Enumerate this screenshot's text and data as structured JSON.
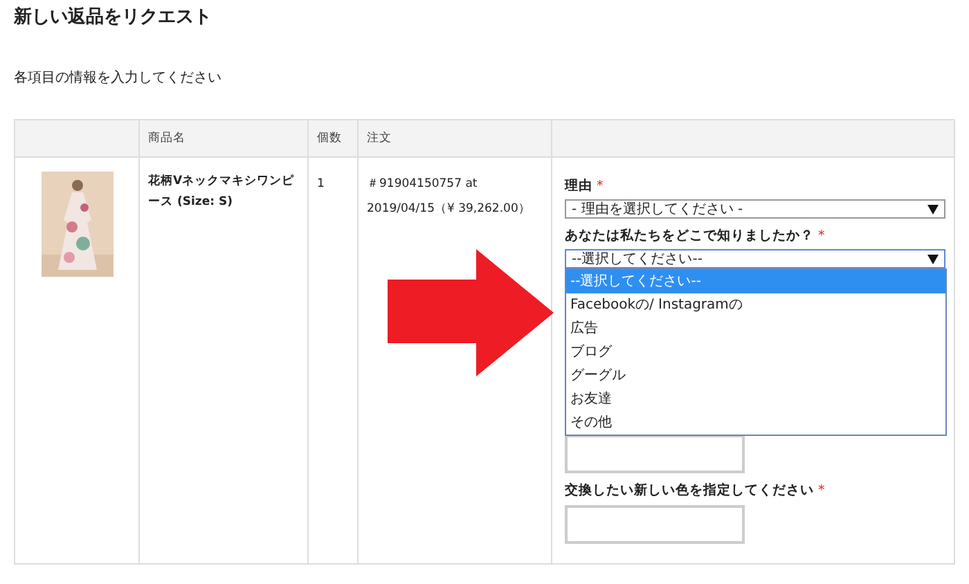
{
  "page": {
    "title": "新しい返品をリクエスト",
    "subtitle": "各項目の情報を入力してください"
  },
  "table": {
    "columns": [
      "商品名",
      "個数",
      "注文"
    ],
    "rows": [
      {
        "product": "花柄Vネックマキシワンピース",
        "size": "(Size: S)",
        "quantity": "1",
        "order": "＃91904150757 at 2019/04/15（¥ 39,262.00）",
        "fields": [
          {
            "kind": "select",
            "label": "理由",
            "mark": "*",
            "value": "- 理由を選択してください -",
            "open": false
          },
          {
            "kind": "select",
            "label": "あなたは私たちをどこで知りましたか？",
            "mark": "*",
            "value": "--選択してください--",
            "open": true,
            "options": [
              {
                "label": "--選択してください--",
                "selected": true
              },
              {
                "label": "Facebookの/ Instagramの",
                "selected": false
              },
              {
                "label": "広告",
                "selected": false
              },
              {
                "label": "ブログ",
                "selected": false
              },
              {
                "label": "グーグル",
                "selected": false
              },
              {
                "label": "お友達",
                "selected": false
              },
              {
                "label": "その他",
                "selected": false
              }
            ]
          },
          {
            "kind": "input"
          },
          {
            "kind": "input",
            "label": "交換したい新しい色を指定してください",
            "mark": "*"
          }
        ]
      }
    ]
  },
  "annotation": {
    "kind": "arrow"
  }
}
